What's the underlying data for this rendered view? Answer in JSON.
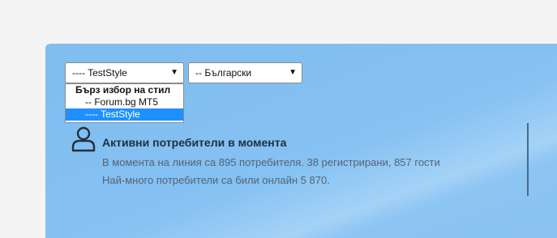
{
  "style_select": {
    "value": "---- TestStyle",
    "options_heading": "Бърз избор на стил",
    "options": [
      "-- Forum.bg MT5",
      "---- TestStyle"
    ]
  },
  "lang_select": {
    "value": "-- Български"
  },
  "online": {
    "title": "Активни потребители в момента",
    "line1": "В момента на линия са 895 потребителя. 38 регистрирани, 857 гости",
    "line2": "Най-много потребители са били онлайн 5 870."
  },
  "icons": {
    "online_users": "user-icon",
    "dropdown_arrow": "triangle-down-icon"
  },
  "colors": {
    "panel": "#85c1f2",
    "selected_option": "#1e90ff"
  }
}
